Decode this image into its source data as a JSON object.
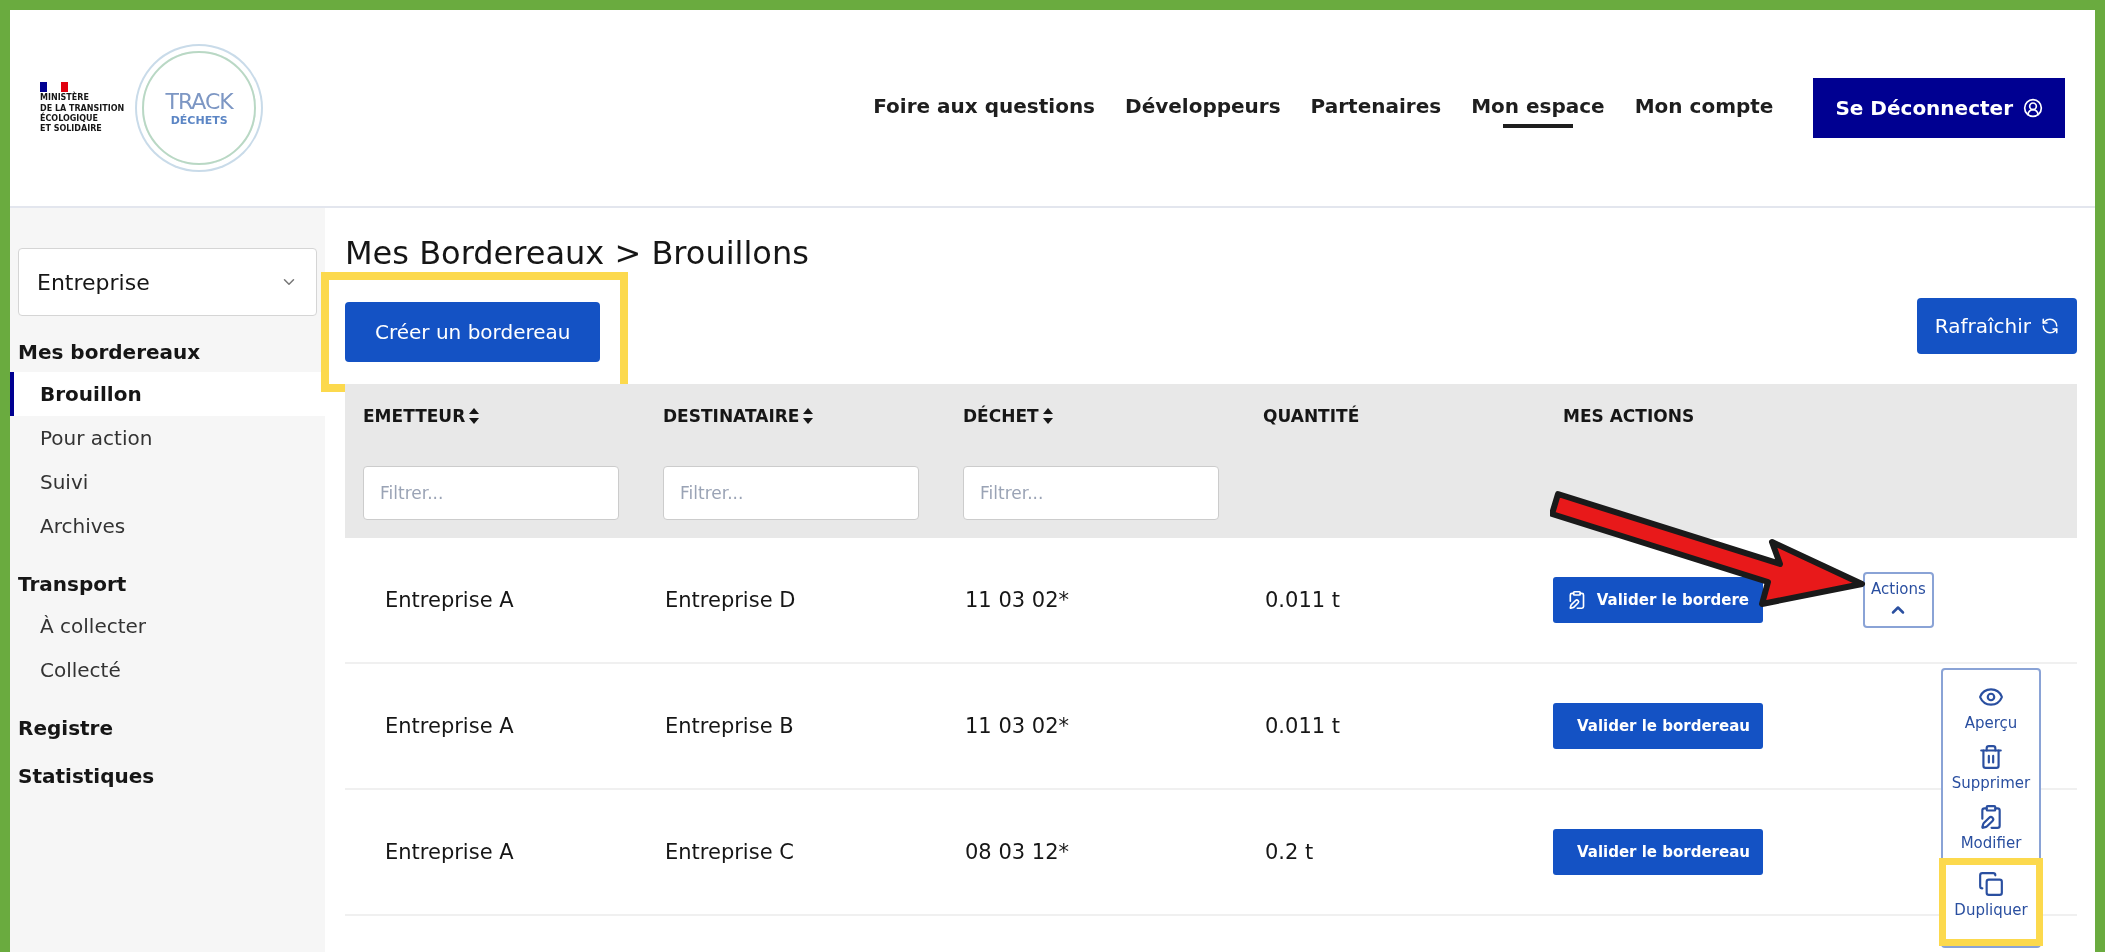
{
  "header": {
    "ministry": {
      "lines": [
        "MINISTÈRE",
        "DE LA TRANSITION",
        "ÉCOLOGIQUE",
        "ET SOLIDAIRE"
      ]
    },
    "logo": {
      "top": "TRACK",
      "bottom": "DÉCHETS"
    },
    "nav": [
      {
        "label": "Foire aux questions",
        "selected": false
      },
      {
        "label": "Développeurs",
        "selected": false
      },
      {
        "label": "Partenaires",
        "selected": false
      },
      {
        "label": "Mon espace",
        "selected": true
      },
      {
        "label": "Mon compte",
        "selected": false
      }
    ],
    "logout": "Se Déconnecter"
  },
  "sidebar": {
    "company_select": "Entreprise",
    "sections": [
      {
        "title": "Mes bordereaux",
        "items": [
          {
            "label": "Brouillon",
            "selected": true
          },
          {
            "label": "Pour action",
            "selected": false
          },
          {
            "label": "Suivi",
            "selected": false
          },
          {
            "label": "Archives",
            "selected": false
          }
        ]
      },
      {
        "title": "Transport",
        "items": [
          {
            "label": "À collecter",
            "selected": false
          },
          {
            "label": "Collecté",
            "selected": false
          }
        ]
      },
      {
        "title": "Registre"
      },
      {
        "title": "Statistiques"
      }
    ]
  },
  "main": {
    "title": "Mes Bordereaux > Brouillons",
    "create_button": {
      "label": "Créer un bordereau",
      "highlighted": true
    },
    "refresh_button": "Rafraîchir",
    "table": {
      "columns": [
        {
          "label": "EMETTEUR",
          "sortable": true,
          "placeholder": "Filtrer..."
        },
        {
          "label": "DESTINATAIRE",
          "sortable": true,
          "placeholder": "Filtrer..."
        },
        {
          "label": "DÉCHET",
          "sortable": true,
          "placeholder": "Filtrer..."
        },
        {
          "label": "QUANTITÉ",
          "sortable": false
        },
        {
          "label": "MES ACTIONS",
          "sortable": false
        }
      ],
      "rows": [
        {
          "emitter": "Entreprise A",
          "recipient": "Entreprise D",
          "waste": "11 03 02*",
          "quantity": "0.011 t",
          "validate": "Valider le bordere",
          "actions": {
            "label": "Actions",
            "expanded": true,
            "menu": [
              {
                "kind": "eye",
                "label": "Aperçu",
                "highlighted": false
              },
              {
                "kind": "trash",
                "label": "Supprimer",
                "highlighted": false
              },
              {
                "kind": "edit",
                "label": "Modifier",
                "highlighted": false
              },
              {
                "kind": "copy",
                "label": "Dupliquer",
                "highlighted": true
              }
            ]
          }
        },
        {
          "emitter": "Entreprise A",
          "recipient": "Entreprise B",
          "waste": "11 03 02*",
          "quantity": "0.011 t",
          "validate": "Valider le bordereau"
        },
        {
          "emitter": "Entreprise A",
          "recipient": "Entreprise C",
          "waste": "08 03 12*",
          "quantity": "0.2 t",
          "validate": "Valider le bordereau"
        }
      ]
    }
  },
  "annotations": {
    "arrow": true
  }
}
